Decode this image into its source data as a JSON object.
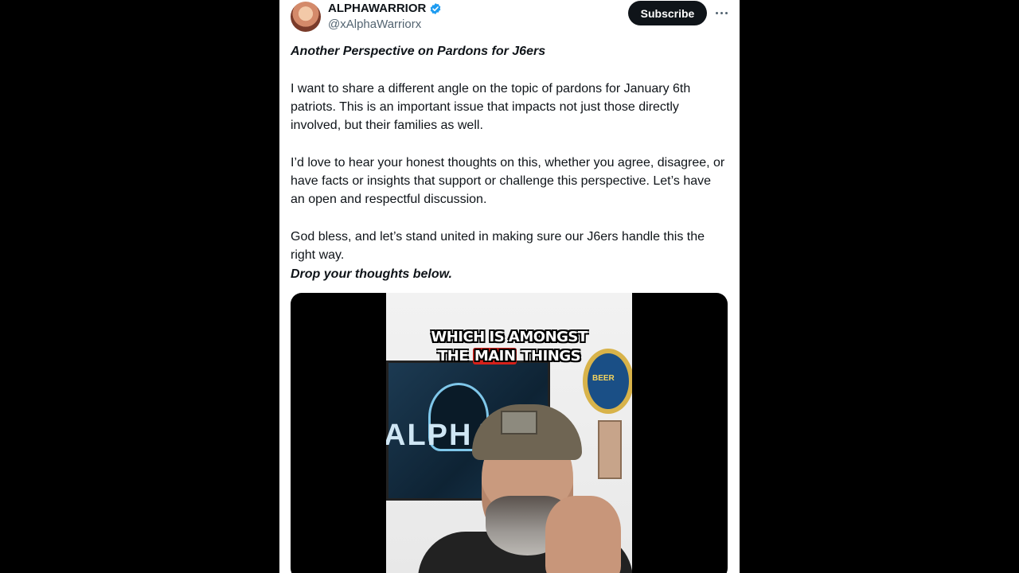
{
  "post": {
    "author": {
      "display_name": "ALPHAWARRIOR",
      "handle": "@xAlphaWarriorx",
      "verified_icon": "verified-badge-icon",
      "avatar": "avatar"
    },
    "subscribe_label": "Subscribe",
    "more_icon": "more-options-icon",
    "title": "Another Perspective on Pardons for J6ers",
    "paragraphs": [
      "I want to share a different angle on the topic of pardons for January 6th patriots. This is an important issue that impacts not just those directly involved, but their families as well.",
      "I’d love to hear your honest thoughts on this, whether you agree, disagree, or have facts or insights that support or challenge this perspective. Let’s have an open and respectful discussion.",
      "God bless, and let’s stand united in making sure our J6ers handle this the right way."
    ],
    "closing": "Drop your thoughts below."
  },
  "video": {
    "caption_line1": "WHICH IS AMONGST",
    "caption_line2_prefix": "THE ",
    "caption_highlight": "MAIN",
    "caption_line2_suffix": " THINGS",
    "tv_logo_text": "ALPHA",
    "porthole_text": "BEER"
  },
  "colors": {
    "background": "#000000",
    "card": "#ffffff",
    "text": "#0f1419",
    "secondary_text": "#536471",
    "verified_blue": "#1d9bf0",
    "subscribe_bg": "#0f1419",
    "caption_highlight": "#d7211b"
  }
}
